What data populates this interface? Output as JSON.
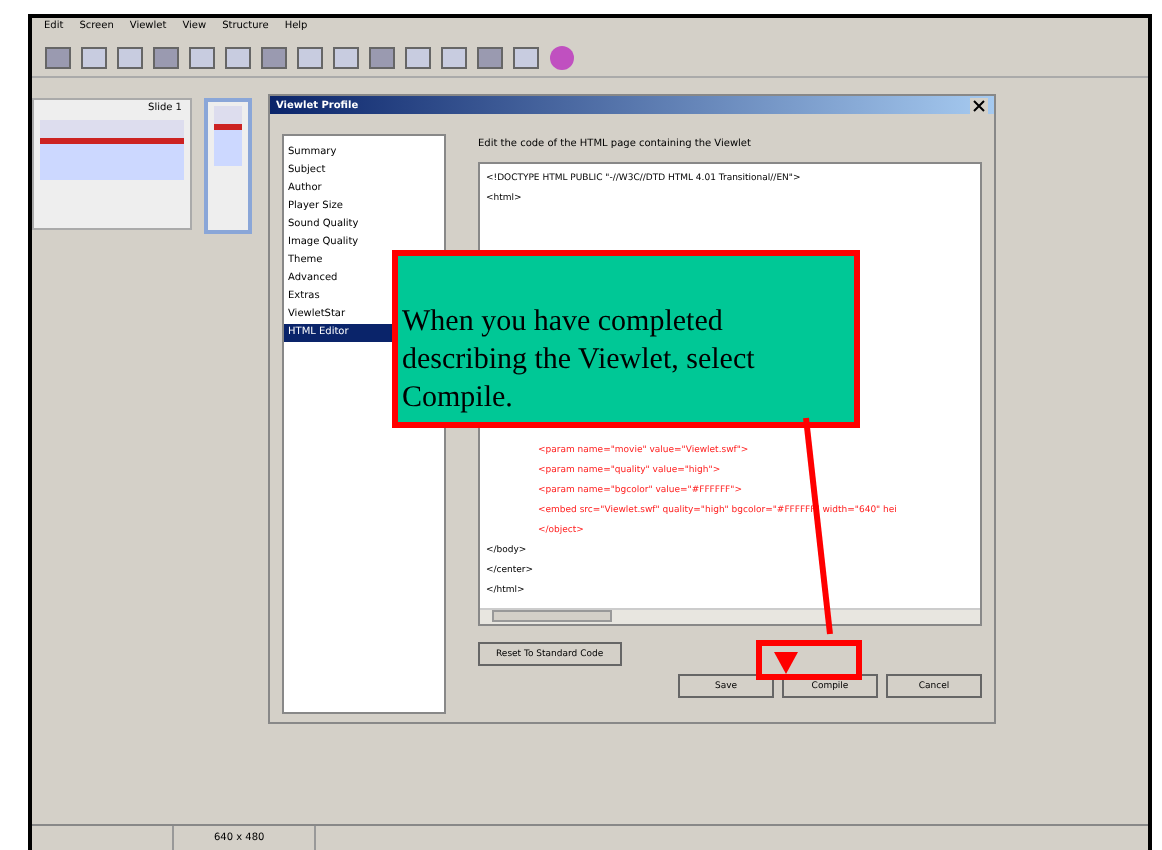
{
  "menu": [
    "Edit",
    "Screen",
    "Viewlet",
    "View",
    "Structure",
    "Help"
  ],
  "slides": [
    {
      "label": "Slide 1",
      "selected": false
    },
    {
      "selected": true
    }
  ],
  "dialog": {
    "title": "Viewlet Profile",
    "sections": [
      {
        "label": "Summary",
        "selected": false
      },
      {
        "label": "Subject",
        "selected": false
      },
      {
        "label": "Author",
        "selected": false
      },
      {
        "label": "Player Size",
        "selected": false
      },
      {
        "label": "Sound Quality",
        "selected": false
      },
      {
        "label": "Image Quality",
        "selected": false
      },
      {
        "label": "Theme",
        "selected": false
      },
      {
        "label": "Advanced",
        "selected": false
      },
      {
        "label": "Extras",
        "selected": false
      },
      {
        "label": "ViewletStar",
        "selected": false
      },
      {
        "label": "HTML Editor",
        "selected": true
      }
    ],
    "instruction": "Edit the code of the HTML page containing the Viewlet",
    "code_top": [
      {
        "text": "<!DOCTYPE HTML PUBLIC \"-//W3C//DTD HTML 4.01 Transitional//EN\">",
        "highlighted": false
      },
      {
        "text": "<html>",
        "highlighted": false
      }
    ],
    "code_bottom": [
      {
        "text": "<param name=\"movie\" value=\"Viewlet.swf\">",
        "highlighted": true
      },
      {
        "text": "<param name=\"quality\" value=\"high\">",
        "highlighted": true
      },
      {
        "text": "<param name=\"bgcolor\" value=\"#FFFFFF\">",
        "highlighted": true
      },
      {
        "text": "<embed src=\"Viewlet.swf\" quality=\"high\" bgcolor=\"#FFFFFF\" width=\"640\" hei",
        "highlighted": true
      },
      {
        "text": "</object>",
        "highlighted": true
      },
      {
        "text": "</body>",
        "highlighted": false
      },
      {
        "text": "</center>",
        "highlighted": false
      },
      {
        "text": "</html>",
        "highlighted": false
      }
    ],
    "reset_button": "Reset To Standard Code",
    "buttons": [
      "Save",
      "Compile",
      "Cancel"
    ]
  },
  "callout": {
    "text": "When you have completed describing the Viewlet, select Compile."
  },
  "status_bar": [
    "640 x 480"
  ]
}
